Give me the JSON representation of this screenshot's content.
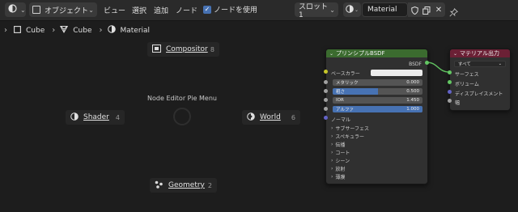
{
  "header": {
    "editor_icon": "node-editor-icon",
    "mode_label": "オブジェクト",
    "menus": [
      "ビュー",
      "選択",
      "追加",
      "ノード"
    ],
    "use_nodes_label": "ノードを使用",
    "use_nodes_checked": true,
    "slot_label": "スロット1",
    "material_name": "Material"
  },
  "breadcrumb": {
    "object": "Cube",
    "mesh": "Cube",
    "material": "Material"
  },
  "pie_menu": {
    "title": "Node Editor Pie Menu",
    "items": [
      {
        "label": "Compositor",
        "shortcut": "8"
      },
      {
        "label": "Shader",
        "shortcut": "4"
      },
      {
        "label": "World",
        "shortcut": "6"
      },
      {
        "label": "Geometry",
        "shortcut": "2"
      }
    ]
  },
  "bsdf_node": {
    "title": "プリンシプルBSDF",
    "output": "BSDF",
    "base_color_label": "ベースカラー",
    "metallic": {
      "label": "メタリック",
      "value": "0.000",
      "fraction": 0.0
    },
    "roughness": {
      "label": "粗さ",
      "value": "0.500",
      "fraction": 0.5
    },
    "ior": {
      "label": "IOR",
      "value": "1.450",
      "fraction": 0.0
    },
    "alpha": {
      "label": "アルファ",
      "value": "1.000",
      "fraction": 1.0
    },
    "normal": "ノーマル",
    "panels": [
      "サブサーフェス",
      "スペキュラー",
      "伝播",
      "コート",
      "シーン",
      "放射",
      "薄膜"
    ]
  },
  "output_node": {
    "title": "マテリアル出力",
    "target": "すべて",
    "inputs": [
      "サーフェス",
      "ボリューム",
      "ディスプレイスメント",
      "幅"
    ]
  },
  "colors": {
    "bsdf_header": "#3b6b2f",
    "output_header": "#6b2035",
    "socket_yellow": "#c7c729",
    "socket_gray": "#a1a1a1",
    "socket_green": "#63c763",
    "socket_purple": "#6363c7",
    "accent_blue": "#4772b3"
  }
}
